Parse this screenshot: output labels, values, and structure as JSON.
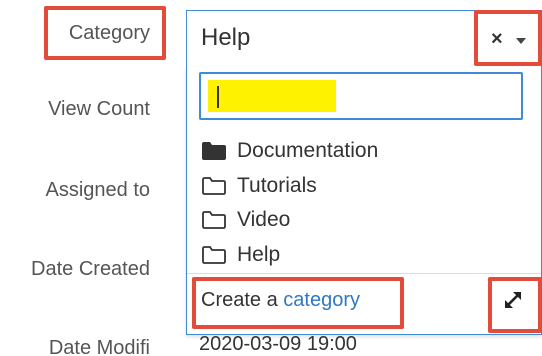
{
  "fields": {
    "category_label": "Category",
    "view_count_label": "View Count",
    "assigned_to_label": "Assigned to",
    "date_created_label": "Date Created",
    "date_modified_label": "Date Modifi",
    "date_modified_value": "2020-03-09 19:00"
  },
  "select": {
    "value": "Help",
    "clear_icon": "×",
    "caret_icon": "chevron-down-icon"
  },
  "dropdown": {
    "search_value": "",
    "items": [
      {
        "label": "Documentation",
        "icon": "folder-filled-icon"
      },
      {
        "label": "Tutorials",
        "icon": "folder-outline-icon"
      },
      {
        "label": "Video",
        "icon": "folder-outline-icon"
      },
      {
        "label": "Help",
        "icon": "folder-outline-icon"
      }
    ],
    "create_prefix": "Create a ",
    "create_link": "category",
    "expand_icon": "expand-icon"
  },
  "colors": {
    "highlight_red": "#e34b3a",
    "focus_blue": "#3d8bd9",
    "link_blue": "#2f78c4",
    "search_highlight_yellow": "#fff200"
  }
}
